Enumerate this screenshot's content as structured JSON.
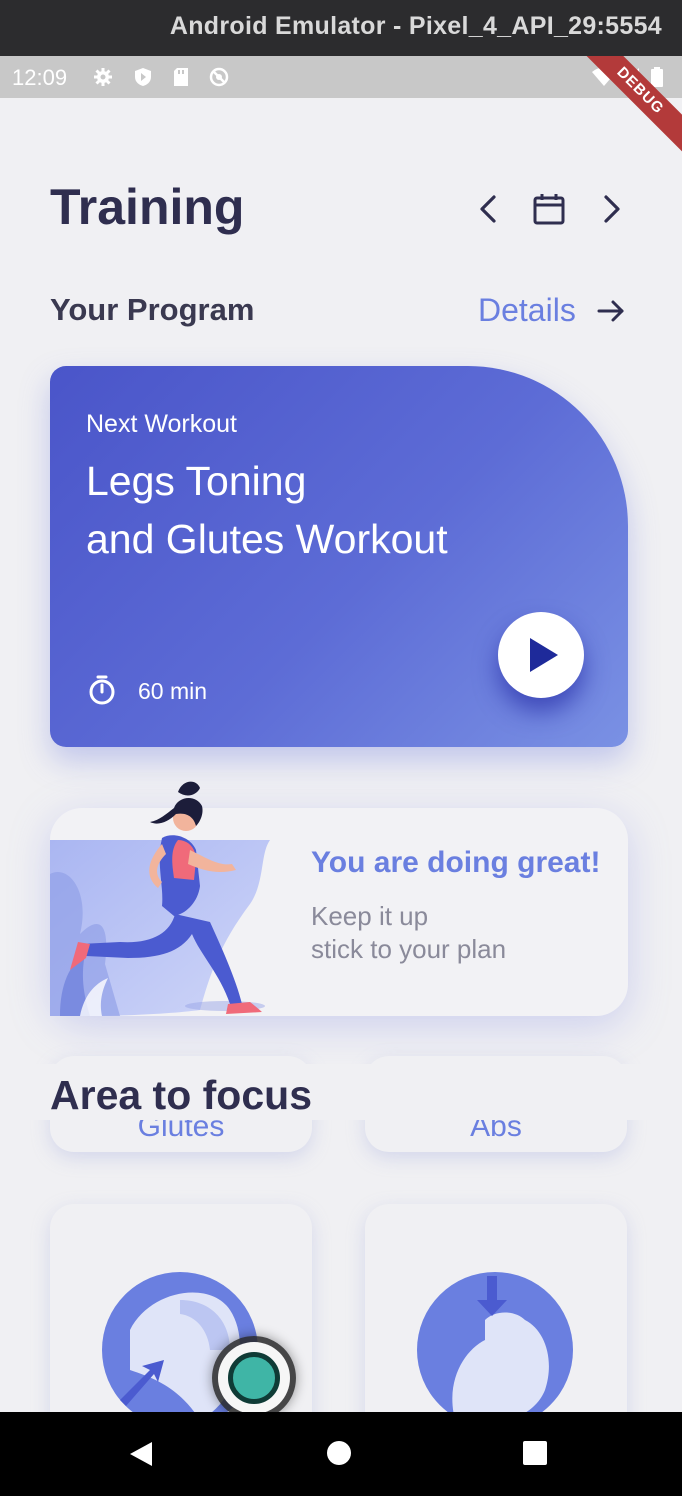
{
  "window": {
    "title": "Android Emulator - Pixel_4_API_29:5554"
  },
  "status_bar": {
    "time": "12:09",
    "debug_banner": "DEBUG"
  },
  "header": {
    "title": "Training"
  },
  "program": {
    "title": "Your Program",
    "details_label": "Details"
  },
  "workout_card": {
    "label": "Next Workout",
    "title_line1": "Legs Toning",
    "title_line2": "and Glutes Workout",
    "duration": "60 min"
  },
  "motivation_card": {
    "headline": "You are doing great!",
    "line1": "Keep it up",
    "line2": "stick to your plan"
  },
  "focus": {
    "title": "Area to focus",
    "areas": [
      {
        "label": "Glutes"
      },
      {
        "label": "Abs"
      }
    ]
  },
  "colors": {
    "accent": "#6a7fe0",
    "card_gradient_start": "#4a55c9",
    "card_gradient_end": "#7a91e4",
    "title": "#2f2e4f"
  },
  "icons": {
    "prev": "chevron-left-icon",
    "calendar": "calendar-icon",
    "next": "chevron-right-icon",
    "details": "arrow-right-icon",
    "timer": "stopwatch-icon",
    "play": "play-icon"
  }
}
